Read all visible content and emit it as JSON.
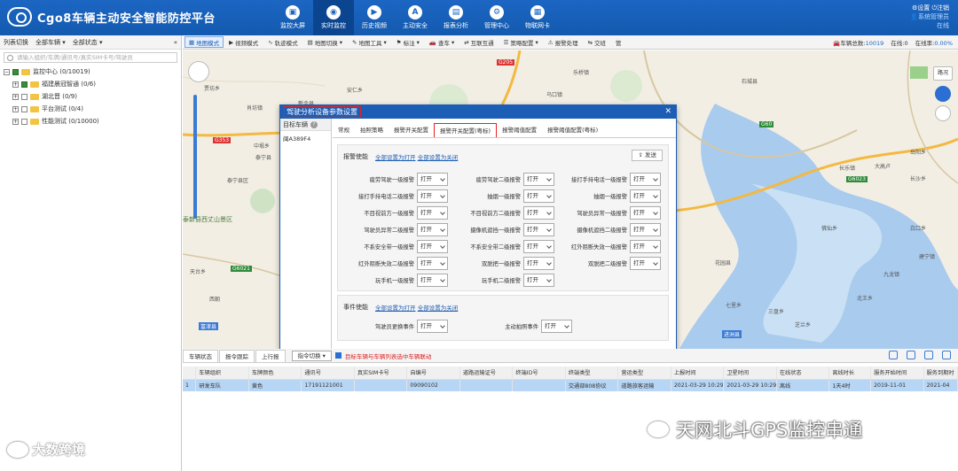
{
  "header": {
    "app_title": "Cgo8车辆主动安全智能防控平台",
    "nav": [
      {
        "label": "监控大屏",
        "icon": "monitor-screen-icon"
      },
      {
        "label": "实时监控",
        "icon": "realtime-monitor-icon",
        "active": true
      },
      {
        "label": "历史视频",
        "icon": "history-video-icon"
      },
      {
        "label": "主动安全",
        "icon": "active-safety-icon"
      },
      {
        "label": "报表分析",
        "icon": "report-icon"
      },
      {
        "label": "管理中心",
        "icon": "management-icon"
      },
      {
        "label": "物联网卡",
        "icon": "iot-card-icon"
      }
    ],
    "settings_label": "设置",
    "logout_label": "注销",
    "user_label": "系统管理员",
    "online_label": "在线"
  },
  "left_panel": {
    "toolbar": [
      "列表切换",
      "全部车辆",
      "全部状态"
    ],
    "search_placeholder": "请输入组织/车牌/通讯号/真实SIM卡号/驾驶员",
    "tree": [
      {
        "label": "监控中心 (0/10019)",
        "level": 0,
        "half": true
      },
      {
        "label": "福建晨冠智通 (0/6)",
        "level": 1,
        "half": true
      },
      {
        "label": "湖北晋 (0/9)",
        "level": 1
      },
      {
        "label": "平台测试 (0/4)",
        "level": 1
      },
      {
        "label": "性能测试 (0/10000)",
        "level": 1
      }
    ]
  },
  "map_toolbar": {
    "buttons": [
      "地图模式",
      "视频模式",
      "轨迹模式",
      "地图切换",
      "地图工具",
      "标注",
      "查车",
      "互联互通",
      "策略配置",
      "报警处理",
      "交班",
      "管"
    ],
    "total_label": "车辆总数:",
    "total_value": "10019",
    "online_label": "在线:",
    "online_value": "0",
    "rate_label": "在线率:",
    "rate_value": "0.00%"
  },
  "map": {
    "labels": [
      "贾坊乡",
      "G353",
      "中塅乡",
      "肖坊镇",
      "泰宁县",
      "泰宁县区",
      "泰新县西丈山景区",
      "天台乡",
      "G6021",
      "西朝",
      "富津县",
      "新余县",
      "安仁乡",
      "G205",
      "乐桥镇",
      "乌口镇",
      "石城县",
      "G60",
      "长乐镇",
      "大高卢",
      "G6023",
      "岳阳乡",
      "佛仙乡",
      "花园县",
      "七里乡",
      "北王乡",
      "白口乡",
      "三盘乡",
      "九龙镇",
      "建宁镇",
      "进洲县",
      "芝兰乡",
      "长沙乡"
    ],
    "road_label": "路况"
  },
  "dialog": {
    "title": "驾驶分析设备参数设置",
    "target_label": "目标车辆",
    "target_vehicle": "闽A389F4",
    "tabs": [
      "常规",
      "拍照策略",
      "报警开关配置",
      "报警开关配置(粤标)",
      "报警阈值配置",
      "报警阈值配置(粤标)"
    ],
    "section1": {
      "title": "报警使能",
      "all_on": "全部设置为打开",
      "all_off": "全部设置为关闭",
      "send": "发送",
      "items": [
        "疲劳驾驶一级报警",
        "疲劳驾驶二级报警",
        "接打手持电话一级报警",
        "接打手持电话二级报警",
        "抽烟一级报警",
        "抽烟一级报警",
        "不目视前方一级报警",
        "不目视前方二级报警",
        "驾驶员异常一级报警",
        "驾驶员异常二级报警",
        "摄像机遮挡一级报警",
        "摄像机遮挡二级报警",
        "不系安全带一级报警",
        "不系安全带二级报警",
        "红外阻断失效一级报警",
        "红外阻断失效二级报警",
        "双脱把一级报警",
        "双脱把二级报警",
        "玩手机一级报警",
        "玩手机二级报警"
      ],
      "value": "打开"
    },
    "section2": {
      "title": "事件使能",
      "all_on": "全部设置为打开",
      "all_off": "全部设置为关闭",
      "items": [
        "驾驶员更换事件",
        "主动拍照事件"
      ],
      "value": "打开"
    }
  },
  "bottom": {
    "tabs": [
      "车辆状态",
      "报令跟踪",
      "上行报"
    ],
    "dropdown": "指令切换",
    "checkbox_label": "目标车辆与车辆列表选中车辆联动",
    "columns": [
      "车辆组织",
      "车牌颜色",
      "通讯号",
      "真实SIM卡号",
      "自编号",
      "道路运输证号",
      "终端ID号",
      "终端类型",
      "营运类型",
      "上报时间",
      "卫星时间",
      "在线状态",
      "离线时长",
      "服务开始时间",
      "服务到期时"
    ],
    "rows": [
      [
        "研发车队",
        "黄色",
        "17191121001",
        "",
        "09090102",
        "",
        "",
        "交通部808协议",
        "道路旅客运输",
        "2021-03-29 10:29:01",
        "2021-03-29 10:29:00",
        "离线",
        "1天4时",
        "2019-11-01",
        "2021-04"
      ]
    ],
    "row_index": "1"
  },
  "watermarks": {
    "left": "大数跨境",
    "right": "天网北斗GPS监控串通"
  }
}
